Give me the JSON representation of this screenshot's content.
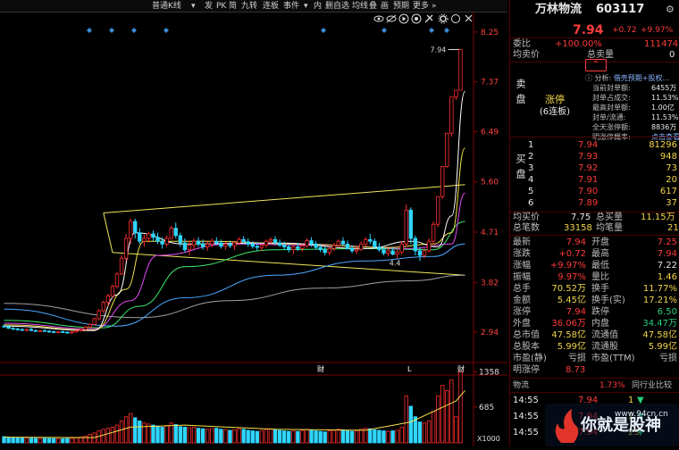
{
  "toolbar": {
    "items": [
      "普通K线",
      "▾",
      "发",
      "PK",
      "简",
      "九转",
      "连板",
      "事件",
      "▾",
      "内",
      "删自选",
      "均线",
      "叠",
      "画",
      "预期",
      "更多",
      "»"
    ],
    "icons": [
      "eye-icon",
      "eye-off-icon",
      "play-icon",
      "target-icon",
      "tools-icon",
      "settings-icon",
      "circle-icon",
      "close-icon"
    ]
  },
  "chart": {
    "price_ticks": [
      "8.25",
      "7.37",
      "6.49",
      "5.60",
      "4.71",
      "3.82",
      "2.94"
    ],
    "high_label": "7.94",
    "low_label": "4.4",
    "event_markers": [
      "财",
      "L",
      "财"
    ],
    "volume_ticks": [
      "1358",
      "685"
    ],
    "volume_unit": "X1000",
    "colors": {
      "up": "#ff2e2e",
      "down": "#2fd6ff",
      "ma5": "#ffffff",
      "ma10": "#f5e04a",
      "ma20": "#e44cf5",
      "ma30": "#3ee86b",
      "ma60": "#4aa8ff",
      "ma120": "#a0a0a0",
      "channel": "#f2e65a"
    }
  },
  "chart_data": {
    "type": "candlestick",
    "ylim": [
      2.5,
      8.5
    ],
    "candles": [
      [
        3.05,
        3.08,
        3.02,
        3.04
      ],
      [
        3.04,
        3.06,
        3.0,
        3.01
      ],
      [
        3.01,
        3.03,
        2.98,
        3.0
      ],
      [
        3.0,
        3.02,
        2.97,
        2.99
      ],
      [
        2.99,
        3.01,
        2.96,
        2.98
      ],
      [
        2.98,
        3.0,
        2.95,
        2.99
      ],
      [
        2.99,
        3.02,
        2.96,
        2.97
      ],
      [
        2.97,
        2.99,
        2.95,
        2.96
      ],
      [
        2.96,
        2.98,
        2.94,
        2.97
      ],
      [
        2.97,
        2.99,
        2.95,
        2.96
      ],
      [
        2.96,
        2.98,
        2.93,
        2.95
      ],
      [
        2.95,
        2.97,
        2.93,
        2.94
      ],
      [
        2.94,
        2.96,
        2.92,
        2.95
      ],
      [
        2.95,
        2.97,
        2.93,
        2.94
      ],
      [
        2.94,
        2.96,
        2.92,
        2.93
      ],
      [
        2.93,
        2.96,
        2.91,
        2.95
      ],
      [
        2.95,
        2.98,
        2.93,
        2.97
      ],
      [
        2.97,
        3.0,
        2.95,
        2.99
      ],
      [
        2.99,
        3.05,
        2.97,
        3.03
      ],
      [
        3.03,
        3.1,
        3.0,
        3.08
      ],
      [
        3.08,
        3.2,
        3.06,
        3.18
      ],
      [
        3.18,
        3.35,
        3.15,
        3.32
      ],
      [
        3.32,
        3.5,
        3.28,
        3.47
      ],
      [
        3.47,
        3.62,
        3.4,
        3.58
      ],
      [
        3.58,
        3.78,
        3.55,
        3.75
      ],
      [
        3.75,
        4.0,
        3.72,
        3.97
      ],
      [
        3.97,
        4.3,
        3.95,
        4.25
      ],
      [
        4.25,
        4.68,
        4.2,
        4.6
      ],
      [
        4.6,
        4.95,
        4.5,
        4.9
      ],
      [
        4.9,
        4.95,
        4.6,
        4.7
      ],
      [
        4.7,
        4.78,
        4.5,
        4.55
      ],
      [
        4.55,
        4.66,
        4.45,
        4.6
      ],
      [
        4.6,
        4.72,
        4.52,
        4.68
      ],
      [
        4.68,
        4.74,
        4.55,
        4.62
      ],
      [
        4.62,
        4.7,
        4.5,
        4.55
      ],
      [
        4.55,
        4.62,
        4.42,
        4.5
      ],
      [
        4.5,
        4.65,
        4.46,
        4.6
      ],
      [
        4.6,
        4.82,
        4.58,
        4.78
      ],
      [
        4.78,
        4.88,
        4.6,
        4.65
      ],
      [
        4.65,
        4.7,
        4.45,
        4.52
      ],
      [
        4.52,
        4.6,
        4.35,
        4.4
      ],
      [
        4.4,
        4.55,
        4.3,
        4.48
      ],
      [
        4.48,
        4.6,
        4.4,
        4.55
      ],
      [
        4.55,
        4.62,
        4.45,
        4.5
      ],
      [
        4.5,
        4.58,
        4.4,
        4.45
      ],
      [
        4.45,
        4.55,
        4.38,
        4.5
      ],
      [
        4.5,
        4.6,
        4.44,
        4.55
      ],
      [
        4.55,
        4.62,
        4.48,
        4.52
      ],
      [
        4.52,
        4.58,
        4.42,
        4.46
      ],
      [
        4.46,
        4.54,
        4.4,
        4.5
      ],
      [
        4.5,
        4.56,
        4.43,
        4.47
      ],
      [
        4.47,
        4.55,
        4.4,
        4.52
      ],
      [
        4.52,
        4.62,
        4.48,
        4.58
      ],
      [
        4.58,
        4.64,
        4.5,
        4.54
      ],
      [
        4.54,
        4.6,
        4.45,
        4.5
      ],
      [
        4.5,
        4.55,
        4.42,
        4.46
      ],
      [
        4.46,
        4.52,
        4.38,
        4.44
      ],
      [
        4.44,
        4.5,
        4.38,
        4.48
      ],
      [
        4.48,
        4.58,
        4.44,
        4.55
      ],
      [
        4.55,
        4.62,
        4.5,
        4.58
      ],
      [
        4.58,
        4.64,
        4.5,
        4.52
      ],
      [
        4.52,
        4.58,
        4.45,
        4.48
      ],
      [
        4.48,
        4.54,
        4.4,
        4.45
      ],
      [
        4.45,
        4.5,
        4.35,
        4.4
      ],
      [
        4.4,
        4.48,
        4.32,
        4.45
      ],
      [
        4.45,
        4.52,
        4.38,
        4.42
      ],
      [
        4.42,
        4.5,
        4.36,
        4.47
      ],
      [
        4.47,
        4.6,
        4.44,
        4.56
      ],
      [
        4.56,
        4.62,
        4.45,
        4.5
      ],
      [
        4.5,
        4.55,
        4.4,
        4.44
      ],
      [
        4.44,
        4.5,
        4.36,
        4.4
      ],
      [
        4.4,
        4.46,
        4.3,
        4.35
      ],
      [
        4.35,
        4.45,
        4.3,
        4.42
      ],
      [
        4.42,
        4.52,
        4.38,
        4.48
      ],
      [
        4.48,
        4.58,
        4.44,
        4.55
      ],
      [
        4.55,
        4.62,
        4.48,
        4.5
      ],
      [
        4.5,
        4.56,
        4.4,
        4.42
      ],
      [
        4.42,
        4.48,
        4.34,
        4.38
      ],
      [
        4.38,
        4.46,
        4.32,
        4.4
      ],
      [
        4.4,
        4.55,
        4.38,
        4.5
      ],
      [
        4.5,
        4.62,
        4.46,
        4.58
      ],
      [
        4.58,
        4.68,
        4.5,
        4.55
      ],
      [
        4.55,
        4.6,
        4.42,
        4.45
      ],
      [
        4.45,
        4.52,
        4.36,
        4.4
      ],
      [
        4.4,
        4.46,
        4.3,
        4.34
      ],
      [
        4.34,
        4.42,
        4.28,
        4.38
      ],
      [
        4.38,
        4.44,
        4.3,
        4.32
      ],
      [
        4.32,
        4.4,
        4.25,
        4.36
      ],
      [
        4.36,
        4.55,
        4.32,
        4.5
      ],
      [
        4.5,
        5.2,
        4.45,
        5.1
      ],
      [
        5.1,
        5.15,
        4.5,
        4.6
      ],
      [
        4.6,
        4.65,
        4.3,
        4.38
      ],
      [
        4.38,
        4.45,
        4.2,
        4.3
      ],
      [
        4.3,
        4.42,
        4.25,
        4.38
      ],
      [
        4.38,
        4.6,
        4.35,
        4.55
      ],
      [
        4.55,
        4.9,
        4.5,
        4.85
      ],
      [
        4.85,
        5.34,
        4.8,
        5.34
      ],
      [
        5.34,
        5.87,
        5.3,
        5.87
      ],
      [
        5.87,
        6.46,
        5.85,
        6.46
      ],
      [
        6.46,
        7.1,
        6.4,
        7.1
      ],
      [
        7.1,
        7.22,
        7.05,
        7.22
      ],
      [
        7.22,
        7.94,
        7.22,
        7.94
      ]
    ],
    "volume": [
      120,
      110,
      100,
      95,
      98,
      90,
      92,
      88,
      85,
      90,
      86,
      84,
      82,
      80,
      85,
      88,
      95,
      110,
      130,
      160,
      190,
      230,
      260,
      280,
      300,
      340,
      420,
      500,
      560,
      480,
      420,
      380,
      360,
      340,
      320,
      300,
      330,
      380,
      350,
      310,
      300,
      290,
      300,
      280,
      270,
      260,
      270,
      280,
      260,
      250,
      240,
      250,
      270,
      260,
      240,
      230,
      220,
      240,
      260,
      270,
      250,
      240,
      230,
      220,
      230,
      220,
      240,
      260,
      240,
      230,
      220,
      210,
      230,
      240,
      260,
      250,
      230,
      220,
      230,
      260,
      280,
      270,
      250,
      240,
      230,
      220,
      230,
      240,
      300,
      900,
      700,
      500,
      400,
      380,
      420,
      600,
      900,
      1100,
      1000,
      1200,
      500,
      1358
    ],
    "volume_ylim": [
      0,
      1400
    ],
    "ma5": [
      [
        0,
        3.05
      ],
      [
        20,
        2.97
      ],
      [
        25,
        3.6
      ],
      [
        29,
        4.7
      ],
      [
        40,
        4.5
      ],
      [
        60,
        4.52
      ],
      [
        80,
        4.42
      ],
      [
        90,
        4.55
      ],
      [
        96,
        4.45
      ],
      [
        99,
        5.0
      ],
      [
        102,
        7.2
      ]
    ],
    "ma10": [
      [
        0,
        3.07
      ],
      [
        20,
        2.98
      ],
      [
        27,
        3.7
      ],
      [
        31,
        4.55
      ],
      [
        45,
        4.55
      ],
      [
        65,
        4.5
      ],
      [
        85,
        4.44
      ],
      [
        95,
        4.5
      ],
      [
        99,
        4.7
      ],
      [
        102,
        6.2
      ]
    ],
    "ma20": [
      [
        0,
        3.1
      ],
      [
        20,
        3.0
      ],
      [
        28,
        3.5
      ],
      [
        34,
        4.3
      ],
      [
        50,
        4.5
      ],
      [
        70,
        4.48
      ],
      [
        90,
        4.42
      ],
      [
        99,
        4.5
      ],
      [
        102,
        5.4
      ]
    ],
    "ma30": [
      [
        0,
        3.15
      ],
      [
        22,
        3.02
      ],
      [
        30,
        3.4
      ],
      [
        40,
        4.1
      ],
      [
        60,
        4.4
      ],
      [
        80,
        4.42
      ],
      [
        95,
        4.4
      ],
      [
        102,
        4.9
      ]
    ],
    "ma60": [
      [
        0,
        3.35
      ],
      [
        25,
        3.05
      ],
      [
        40,
        3.55
      ],
      [
        60,
        3.95
      ],
      [
        80,
        4.2
      ],
      [
        95,
        4.28
      ],
      [
        102,
        4.5
      ]
    ],
    "ma120": [
      [
        0,
        3.45
      ],
      [
        30,
        3.2
      ],
      [
        50,
        3.5
      ],
      [
        70,
        3.72
      ],
      [
        90,
        3.85
      ],
      [
        102,
        3.95
      ]
    ],
    "channel_upper": [
      [
        22,
        5.05
      ],
      [
        102,
        5.55
      ]
    ],
    "channel_lower": [
      [
        24,
        4.35
      ],
      [
        102,
        3.95
      ]
    ],
    "volume_ma": [
      [
        0,
        110
      ],
      [
        20,
        100
      ],
      [
        28,
        300
      ],
      [
        40,
        340
      ],
      [
        60,
        260
      ],
      [
        80,
        240
      ],
      [
        90,
        400
      ],
      [
        100,
        800
      ],
      [
        102,
        1000
      ]
    ]
  },
  "panel": {
    "stock_name": "万林物流",
    "stock_code": "603117",
    "price": "7.94",
    "change": "+0.72",
    "change_pct": "+9.97%",
    "weibi_label": "委比",
    "weibi_value": "+100.00%",
    "weicha_value": "111474",
    "junmaijia_label": "均卖价",
    "zongmaiiliang_label": "总卖量",
    "zongmaiiliang_value": "0",
    "sell_label": "卖盘",
    "limit_up_label": "涨停",
    "limit_up_streak": "(6连板)",
    "analysis": {
      "title": "分析:",
      "tag": "借壳预期+股权...",
      "rows": [
        {
          "label": "当前封单额:",
          "value": "6455万"
        },
        {
          "label": "封单占成交:",
          "value": "11.53%"
        },
        {
          "label": "最高封单额:",
          "value": "1.00亿"
        },
        {
          "label": "封单/流通:",
          "value": "11.53%"
        },
        {
          "label": "全天涨停额:",
          "value": "8836万"
        },
        {
          "label": "明涨停概率:",
          "value": "点击查看"
        }
      ]
    },
    "buy_label": "买盘",
    "buy_orders": [
      {
        "level": "1",
        "price": "7.94",
        "volume": "81296"
      },
      {
        "level": "2",
        "price": "7.93",
        "volume": "948"
      },
      {
        "level": "3",
        "price": "7.92",
        "volume": "73"
      },
      {
        "level": "4",
        "price": "7.91",
        "volume": "20"
      },
      {
        "level": "5",
        "price": "7.90",
        "volume": "617"
      },
      {
        "level": "6",
        "price": "7.89",
        "volume": "37"
      }
    ],
    "avg_buy": {
      "label": "均买价",
      "value": "7.75",
      "label2": "总买量",
      "value2": "11.15万"
    },
    "total_trades": {
      "label": "总笔数",
      "value": "33158",
      "label2": "均笔量",
      "value2": "21"
    },
    "stats": [
      {
        "l1": "最新",
        "v1": "7.94",
        "l2": "开盘",
        "v2": "7.25"
      },
      {
        "l1": "涨跌",
        "v1": "+0.72",
        "l2": "最高",
        "v2": "7.94"
      },
      {
        "l1": "涨幅",
        "v1": "+9.97%",
        "l2": "最低",
        "v2": "7.22"
      },
      {
        "l1": "振幅",
        "v1": "9.97%",
        "l2": "量比",
        "v2": "1.46"
      },
      {
        "l1": "总手",
        "v1": "70.52万",
        "l2": "换手",
        "v2": "11.77%"
      },
      {
        "l1": "金额",
        "v1": "5.45亿",
        "l2": "换手(实)",
        "v2": "17.21%"
      },
      {
        "l1": "涨停",
        "v1": "7.94",
        "l2": "跌停",
        "v2": "6.50"
      },
      {
        "l1": "外盘",
        "v1": "36.06万",
        "l2": "内盘",
        "v2": "34.47万"
      },
      {
        "l1": "总市值",
        "v1": "47.58亿",
        "l2": "流通值",
        "v2": "47.58亿"
      },
      {
        "l1": "总股本",
        "v1": "5.99亿",
        "l2": "流通股",
        "v2": "5.99亿"
      },
      {
        "l1": "市盈(静)",
        "v1": "亏损",
        "l2": "市盈(TTM)",
        "v2": "亏损"
      }
    ],
    "next_limit": {
      "label": "明涨停",
      "value": "8.73"
    },
    "sector": {
      "name": "物流",
      "pct": "1.73%",
      "link": "同行业比较"
    },
    "ticks": [
      {
        "time": "14:55",
        "price": "7.94",
        "volume": "1"
      },
      {
        "time": "14:55",
        "price": "7.94",
        "volume": "2"
      },
      {
        "time": "14:55",
        "price": "7.94",
        "volume": "23"
      }
    ]
  },
  "watermark": {
    "text": "你就是股神",
    "site": "www.94cn.cn"
  }
}
